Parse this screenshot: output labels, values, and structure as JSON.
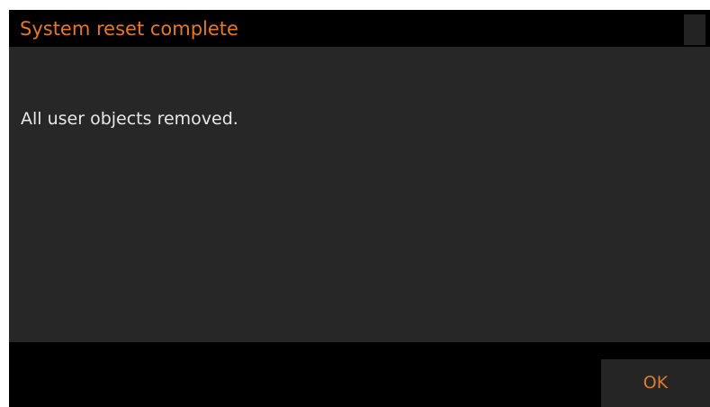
{
  "dialog": {
    "title": "System reset complete",
    "message": "All user objects removed.",
    "ok_label": "OK"
  },
  "colors": {
    "accent": "#e07a2a",
    "content_bg": "#262726",
    "bar_bg": "#000000",
    "text": "#e8e8e8",
    "button_bg": "#252525"
  }
}
